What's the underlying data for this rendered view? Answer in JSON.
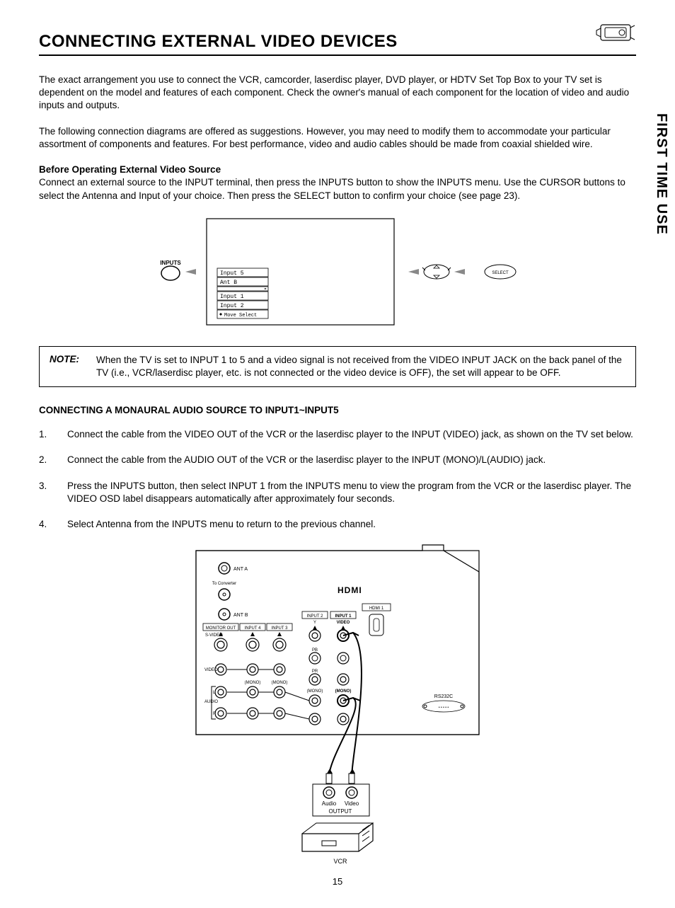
{
  "sideTab": "FIRST TIME USE",
  "title": "CONNECTING EXTERNAL VIDEO DEVICES",
  "para1": "The exact arrangement you use to connect the VCR, camcorder, laserdisc player, DVD player, or HDTV Set Top Box to your TV set is dependent on the model and features of each component.  Check the owner's manual of each component for the location of video and audio inputs and outputs.",
  "para2": "The following connection diagrams are offered as suggestions.  However, you may need to modify them to accommodate your particular assortment of components and features.  For best performance, video and audio cables should be made from coaxial shielded wire.",
  "beforeHeading": "Before Operating External Video Source",
  "beforeText": "Connect an external source to the INPUT terminal, then press the INPUTS button to show the INPUTS menu.  Use the CURSOR buttons to select the Antenna and Input of your choice.  Then press the SELECT button to confirm your choice (see page 23).",
  "menu": {
    "buttonLabel": "INPUTS",
    "items": [
      "Input 5",
      "Ant B",
      "Input 1",
      "Input 2"
    ],
    "hint": "Move     Select",
    "selectBtn": "SELECT"
  },
  "note": {
    "label": "NOTE:",
    "text": "When the TV is set to INPUT 1 to 5 and a video signal is not received from the VIDEO INPUT JACK on the back panel of the TV (i.e., VCR/laserdisc player, etc. is not connected or the video device is OFF), the set will appear to be OFF."
  },
  "subhead": "CONNECTING A MONAURAL AUDIO SOURCE TO INPUT1~INPUT5",
  "steps": [
    "Connect the cable from the VIDEO OUT of the VCR or the laserdisc player to the INPUT (VIDEO) jack, as shown on the TV set below.",
    "Connect the cable from the AUDIO OUT of the VCR or the laserdisc player to the INPUT (MONO)/L(AUDIO) jack.",
    "Press the INPUTS button, then select INPUT 1 from the INPUTS menu to view the program from the VCR or the laserdisc player.  The VIDEO OSD label disappears automatically after approximately four seconds.",
    "Select Antenna from the INPUTS menu to return to the previous channel."
  ],
  "backPanel": {
    "hdmi": "HDMI",
    "hdmi1": "HDMI 1",
    "antA": "ANT A",
    "antB": "ANT B",
    "toConverter": "To Converter",
    "monitorOut": "MONITOR OUT",
    "svideoRow": "S-VIDEO",
    "input4": "INPUT 4",
    "input3": "INPUT 3",
    "input2": "INPUT 2",
    "input1": "INPUT 1",
    "y": "Y",
    "video": "VIDEO",
    "videoBold": "VIDEO",
    "pb": "PB",
    "pr": "PR",
    "mono": "(MONO)",
    "monoBold": "(MONO)",
    "l": "L",
    "r": "R",
    "audio": "AUDIO",
    "rs232c": "RS232C",
    "outAudio": "Audio",
    "outVideo": "Video",
    "output": "OUTPUT",
    "vcr": "VCR"
  },
  "pageNumber": "15"
}
